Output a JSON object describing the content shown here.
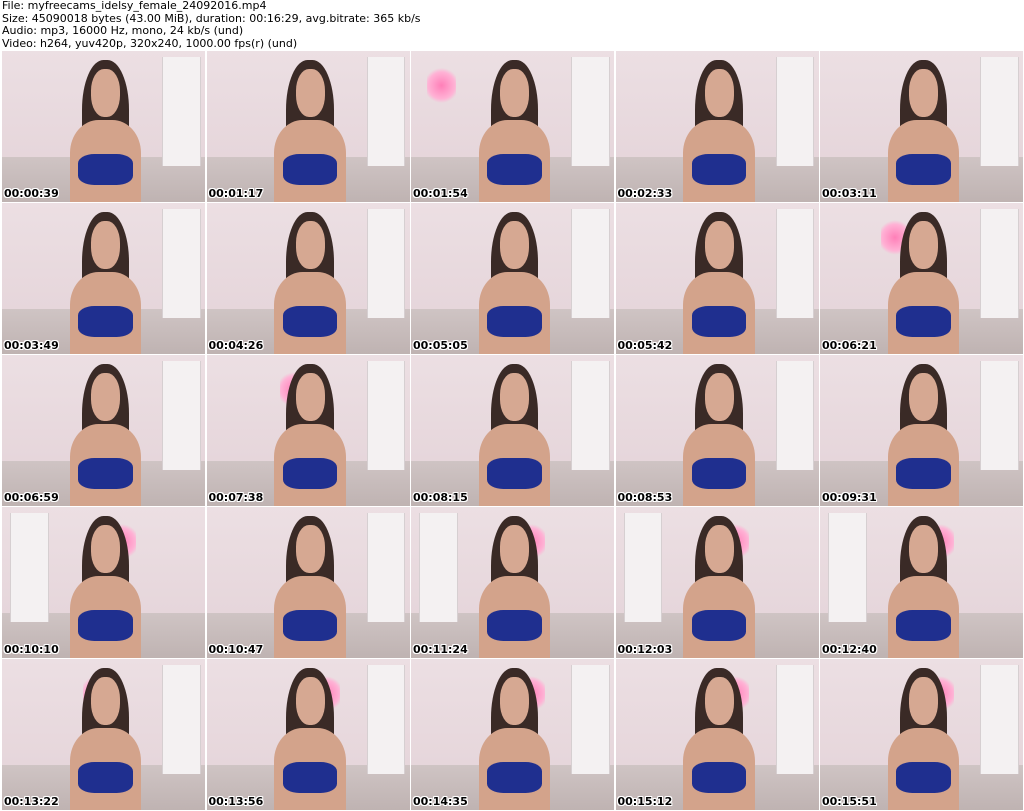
{
  "header": {
    "file": "File: myfreecams_idelsy_female_24092016.mp4",
    "size": "Size: 45090018 bytes (43.00 MiB), duration: 00:16:29, avg.bitrate: 365 kb/s",
    "audio": "Audio: mp3, 16000 Hz, mono, 24 kb/s (und)",
    "video": "Video: h264, yuv420p, 320x240, 1000.00 fps(r) (und)"
  },
  "thumbnails": [
    {
      "timestamp": "00:00:39"
    },
    {
      "timestamp": "00:01:17"
    },
    {
      "timestamp": "00:01:54"
    },
    {
      "timestamp": "00:02:33"
    },
    {
      "timestamp": "00:03:11"
    },
    {
      "timestamp": "00:03:49"
    },
    {
      "timestamp": "00:04:26"
    },
    {
      "timestamp": "00:05:05"
    },
    {
      "timestamp": "00:05:42"
    },
    {
      "timestamp": "00:06:21"
    },
    {
      "timestamp": "00:06:59"
    },
    {
      "timestamp": "00:07:38"
    },
    {
      "timestamp": "00:08:15"
    },
    {
      "timestamp": "00:08:53"
    },
    {
      "timestamp": "00:09:31"
    },
    {
      "timestamp": "00:10:10"
    },
    {
      "timestamp": "00:10:47"
    },
    {
      "timestamp": "00:11:24"
    },
    {
      "timestamp": "00:12:03"
    },
    {
      "timestamp": "00:12:40"
    },
    {
      "timestamp": "00:13:22"
    },
    {
      "timestamp": "00:13:56"
    },
    {
      "timestamp": "00:14:35"
    },
    {
      "timestamp": "00:15:12"
    },
    {
      "timestamp": "00:15:51"
    }
  ]
}
